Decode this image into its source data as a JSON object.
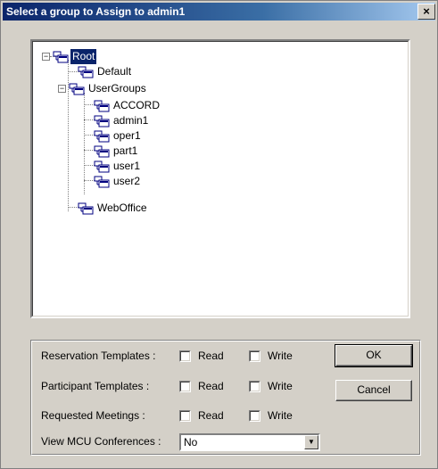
{
  "window": {
    "title": "Select a group to Assign to admin1",
    "close_label": "×"
  },
  "tree": {
    "root": {
      "label": "Root",
      "expanded": true,
      "selected": true
    },
    "children": [
      {
        "label": "Default"
      },
      {
        "label": "UserGroups",
        "expanded": true,
        "children": [
          {
            "label": "ACCORD"
          },
          {
            "label": "admin1"
          },
          {
            "label": "oper1"
          },
          {
            "label": "part1"
          },
          {
            "label": "user1"
          },
          {
            "label": "user2"
          }
        ]
      },
      {
        "label": "WebOffice"
      }
    ],
    "expander_minus": "−"
  },
  "permissions": {
    "rows": [
      {
        "label": "Reservation Templates :",
        "read_label": "Read",
        "write_label": "Write",
        "read": false,
        "write": false
      },
      {
        "label": "Participant Templates  :",
        "read_label": "Read",
        "write_label": "Write",
        "read": false,
        "write": false
      },
      {
        "label": "Requested Meetings    :",
        "read_label": "Read",
        "write_label": "Write",
        "read": false,
        "write": false
      }
    ],
    "mcu_label": "View MCU Conferences :",
    "mcu_value": "No"
  },
  "buttons": {
    "ok_label": "OK",
    "cancel_label": "Cancel"
  }
}
